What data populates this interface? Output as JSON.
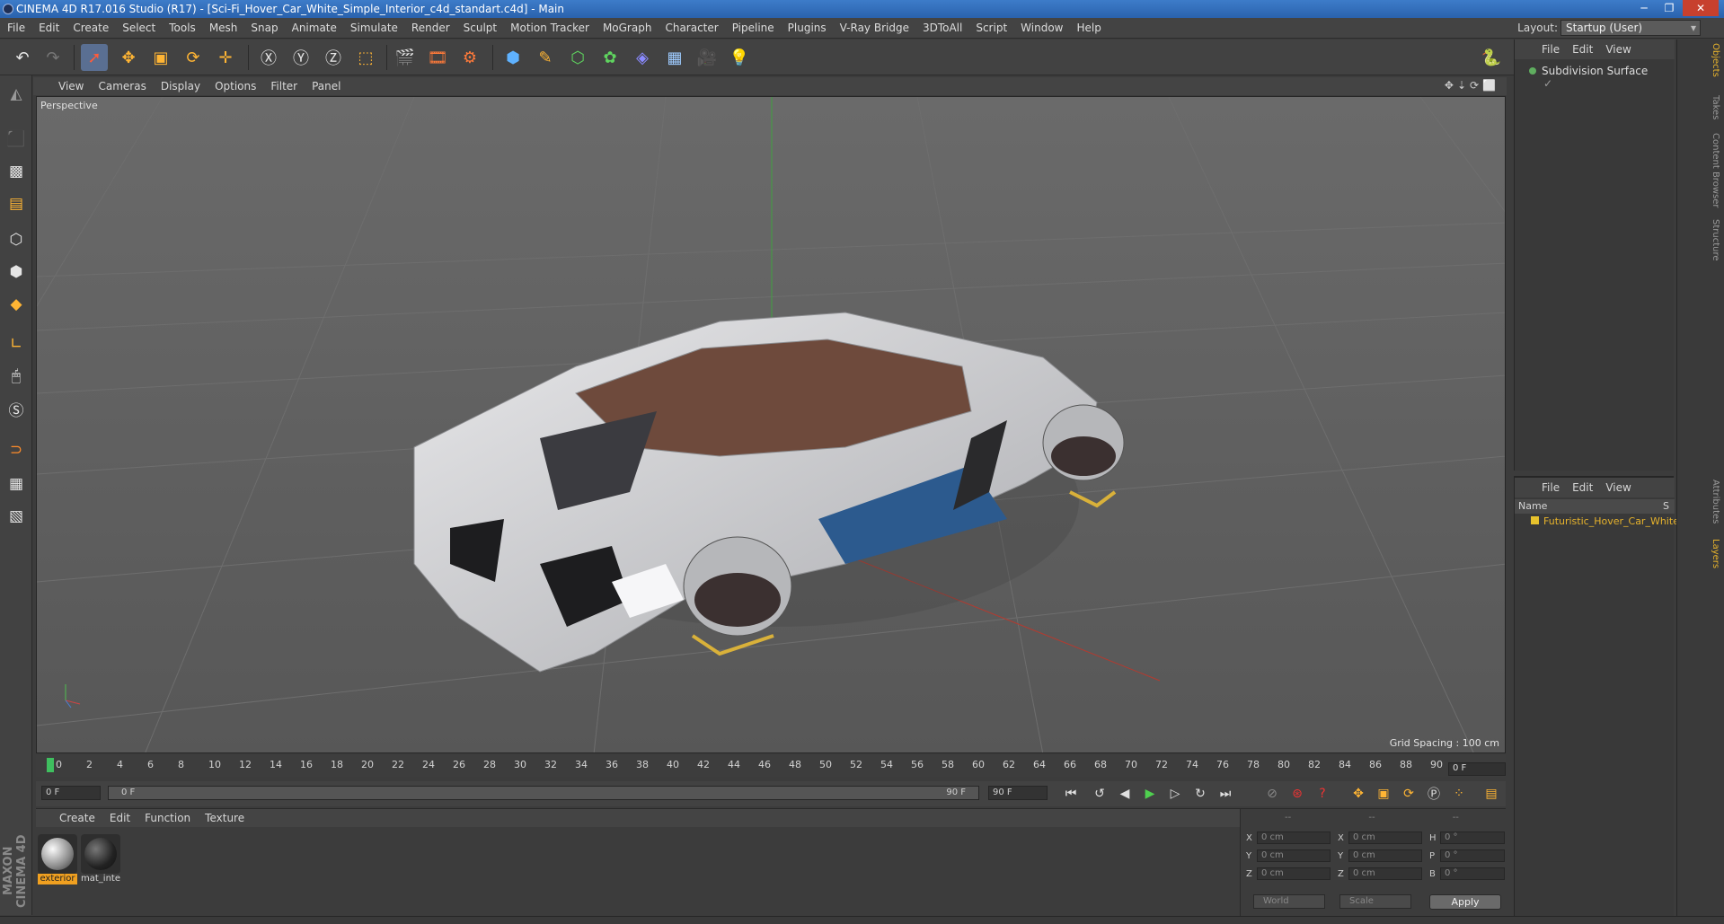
{
  "window": {
    "title": "CINEMA 4D R17.016 Studio (R17) - [Sci-Fi_Hover_Car_White_Simple_Interior_c4d_standart.c4d] - Main"
  },
  "menu": [
    "File",
    "Edit",
    "Create",
    "Select",
    "Tools",
    "Mesh",
    "Snap",
    "Animate",
    "Simulate",
    "Render",
    "Sculpt",
    "Motion Tracker",
    "MoGraph",
    "Character",
    "Pipeline",
    "Plugins",
    "V-Ray Bridge",
    "3DToAll",
    "Script",
    "Window",
    "Help"
  ],
  "layout": {
    "label": "Layout:",
    "value": "Startup (User)"
  },
  "viewport": {
    "menu": [
      "View",
      "Cameras",
      "Display",
      "Options",
      "Filter",
      "Panel"
    ],
    "camera": "Perspective",
    "grid_spacing": "Grid Spacing : 100 cm"
  },
  "timeline": {
    "ticks": [
      "0",
      "2",
      "4",
      "6",
      "8",
      "10",
      "12",
      "14",
      "16",
      "18",
      "20",
      "22",
      "24",
      "26",
      "28",
      "30",
      "32",
      "34",
      "36",
      "38",
      "40",
      "42",
      "44",
      "46",
      "48",
      "50",
      "52",
      "54",
      "56",
      "58",
      "60",
      "62",
      "64",
      "66",
      "68",
      "70",
      "72",
      "74",
      "76",
      "78",
      "80",
      "82",
      "84",
      "86",
      "88",
      "90"
    ],
    "current_frame": "0 F",
    "start_field": "0 F",
    "range_start": "0 F",
    "range_end": "90 F",
    "end_field": "90 F"
  },
  "material_panel": {
    "menu": [
      "Create",
      "Edit",
      "Function",
      "Texture"
    ],
    "materials": [
      {
        "name": "exterior",
        "selected": true
      },
      {
        "name": "mat_inte",
        "selected": false
      }
    ]
  },
  "coords": {
    "rows": [
      {
        "a": "X",
        "av": "0 cm",
        "b": "X",
        "bv": "0 cm",
        "c": "H",
        "cv": "0 °"
      },
      {
        "a": "Y",
        "av": "0 cm",
        "b": "Y",
        "bv": "0 cm",
        "c": "P",
        "cv": "0 °"
      },
      {
        "a": "Z",
        "av": "0 cm",
        "b": "Z",
        "bv": "0 cm",
        "c": "B",
        "cv": "0 °"
      }
    ],
    "header": [
      "--",
      "--",
      "--"
    ],
    "mode": "World",
    "transform": "Scale",
    "apply": "Apply"
  },
  "objects": {
    "menu": [
      "File",
      "Edit",
      "View"
    ],
    "items": [
      {
        "name": "Subdivision Surface"
      }
    ]
  },
  "layers": {
    "menu": [
      "File",
      "Edit",
      "View"
    ],
    "column_name": "Name",
    "column_s": "S",
    "items": [
      {
        "name": "Futuristic_Hover_Car_White",
        "color": "#e7c22c"
      }
    ]
  },
  "side_tabs": [
    "Objects",
    "Takes",
    "Content Browser",
    "Structure",
    "Attributes",
    "Layers"
  ],
  "brand": "MAXON CINEMA 4D"
}
